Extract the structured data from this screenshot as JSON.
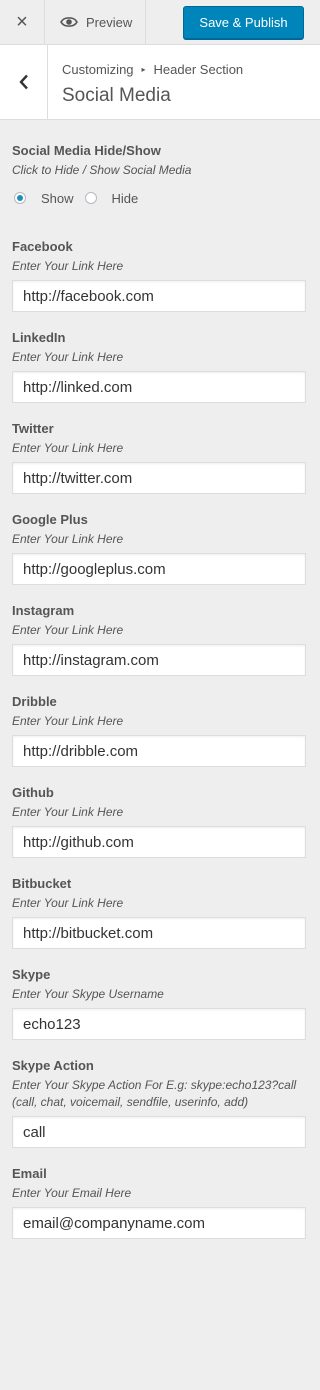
{
  "topbar": {
    "close_label": "×",
    "preview_label": "Preview",
    "publish_label": "Save & Publish"
  },
  "section": {
    "crumb_root": "Customizing",
    "crumb_separator": "▸",
    "crumb_parent": "Header Section",
    "title": "Social Media"
  },
  "visibility": {
    "title": "Social Media Hide/Show",
    "description": "Click to Hide / Show Social Media",
    "options": [
      "Show",
      "Hide"
    ],
    "selected": "Show"
  },
  "fields": [
    {
      "title": "Facebook",
      "description": "Enter Your Link Here",
      "value": "http://facebook.com"
    },
    {
      "title": "LinkedIn",
      "description": "Enter Your Link Here",
      "value": "http://linked.com"
    },
    {
      "title": "Twitter",
      "description": "Enter Your Link Here",
      "value": "http://twitter.com"
    },
    {
      "title": "Google Plus",
      "description": "Enter Your Link Here",
      "value": "http://googleplus.com"
    },
    {
      "title": "Instagram",
      "description": "Enter Your Link Here",
      "value": "http://instagram.com"
    },
    {
      "title": "Dribble",
      "description": "Enter Your Link Here",
      "value": "http://dribble.com"
    },
    {
      "title": "Github",
      "description": "Enter Your Link Here",
      "value": "http://github.com"
    },
    {
      "title": "Bitbucket",
      "description": "Enter Your Link Here",
      "value": "http://bitbucket.com"
    },
    {
      "title": "Skype",
      "description": "Enter Your Skype Username",
      "value": "echo123"
    },
    {
      "title": "Skype Action",
      "description": "Enter Your Skype Action For E.g: skype:echo123?call (call, chat, voicemail, sendfile, userinfo, add)",
      "value": "call"
    },
    {
      "title": "Email",
      "description": "Enter Your Email Here",
      "value": "email@companyname.com"
    }
  ],
  "colors": {
    "accent": "#0085ba",
    "radio_checked": "#1e8cbe",
    "background": "#eeeeee"
  }
}
